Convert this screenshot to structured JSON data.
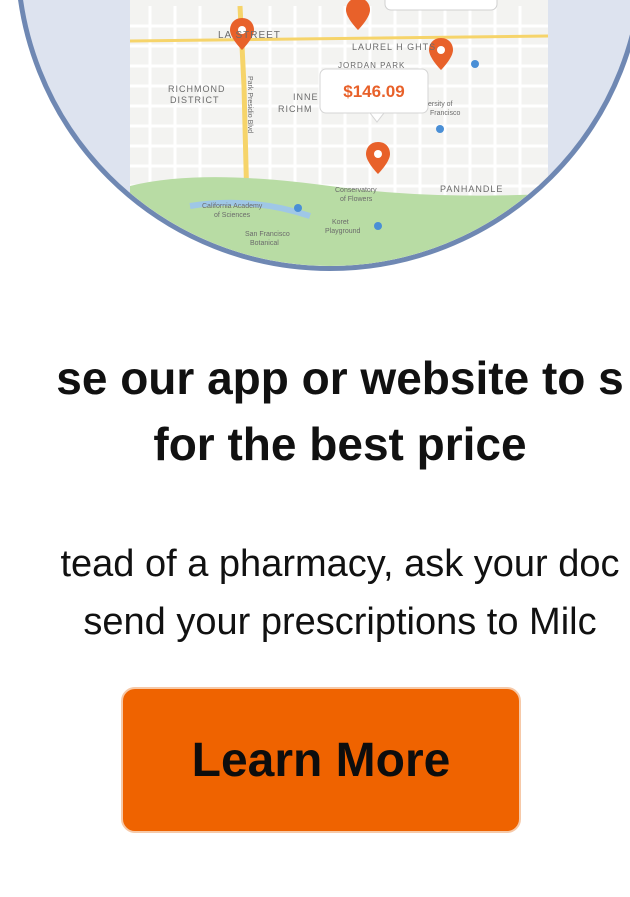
{
  "illustration": {
    "price_bubble": "$146.09",
    "map_labels": {
      "lake_street": "LA   STREET",
      "laurel_heights": "LAUREL H  GHTS",
      "jordan_park": "JORDAN PARK",
      "richmond_district_1": "RICHMOND",
      "richmond_district_2": "DISTRICT",
      "inner_richmond_1": "INNE",
      "inner_richmond_2": "RICHM",
      "panhandle": "PANHANDLE",
      "park_presidio": "Park Presidio Blvd",
      "conservatory_1": "Conservatory",
      "conservatory_2": "of Flowers",
      "california_academy_1": "California Academy",
      "california_academy_2": "of Sciences",
      "koret_1": "Koret",
      "koret_2": "Playground",
      "sf_botanical_1": "San Francisco",
      "sf_botanical_2": "Botanical",
      "university_1": "ersity of",
      "university_2": "Francisco"
    },
    "colors": {
      "circle_fill": "#dde3ef",
      "circle_border": "#6f88b3",
      "pin": "#e8612a",
      "park": "#b8dca4"
    }
  },
  "headline": {
    "line1": "se our app or website to s",
    "line2": "for the best price"
  },
  "body": {
    "line1": "tead of a pharmacy, ask your doc",
    "line2": "send your prescriptions to Milc"
  },
  "cta": {
    "label": "Learn More",
    "color": "#ef6300"
  }
}
